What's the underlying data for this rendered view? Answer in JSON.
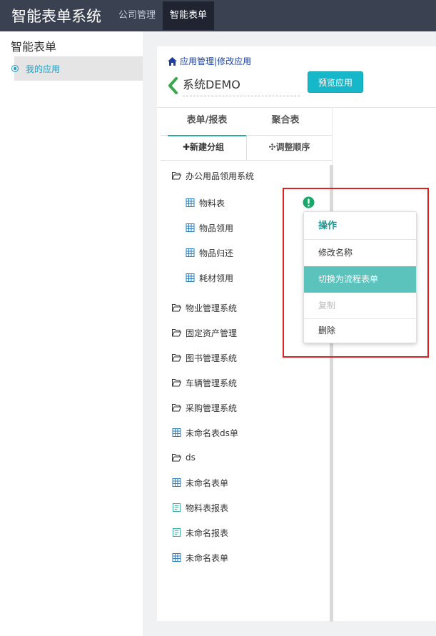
{
  "topbar": {
    "title": "智能表单系统",
    "nav": [
      {
        "label": "公司管理",
        "active": false
      },
      {
        "label": "智能表单",
        "active": true
      }
    ]
  },
  "sidebar": {
    "title": "智能表单",
    "items": [
      {
        "label": "我的应用",
        "icon": "radio-icon"
      }
    ]
  },
  "main": {
    "breadcrumb": {
      "app_manage": "应用管理",
      "separator": "|",
      "edit_app": "修改应用"
    },
    "app_name": "系统DEMO",
    "preview_label": "预览应用"
  },
  "panel": {
    "tabs": [
      {
        "label": "表单/报表",
        "active": true
      },
      {
        "label": "聚合表",
        "active": false
      }
    ],
    "toolbar": {
      "new_group": "✚新建分组",
      "reorder": "✣调整顺序"
    }
  },
  "tree": [
    {
      "label": "办公用品领用系统",
      "type": "folder",
      "level": 0
    },
    {
      "label": "物料表",
      "type": "form",
      "level": 1
    },
    {
      "label": "物品领用",
      "type": "form",
      "level": 1
    },
    {
      "label": "物品归还",
      "type": "form",
      "level": 1
    },
    {
      "label": "耗材领用",
      "type": "form",
      "level": 1
    },
    {
      "label": "物业管理系统",
      "type": "folder",
      "level": 0
    },
    {
      "label": "固定资产管理",
      "type": "folder",
      "level": 0
    },
    {
      "label": "图书管理系统",
      "type": "folder",
      "level": 0
    },
    {
      "label": "车辆管理系统",
      "type": "folder",
      "level": 0
    },
    {
      "label": "采购管理系统",
      "type": "folder",
      "level": 0
    },
    {
      "label": "未命名表ds单",
      "type": "form",
      "level": 0
    },
    {
      "label": "ds",
      "type": "folder",
      "level": 0
    },
    {
      "label": "未命名表单",
      "type": "form",
      "level": 0
    },
    {
      "label": "物料表报表",
      "type": "report",
      "level": 0
    },
    {
      "label": "未命名报表",
      "type": "report",
      "level": 0
    },
    {
      "label": "未命名表单",
      "type": "form",
      "level": 0
    }
  ],
  "context_menu": {
    "header": "操作",
    "items": [
      {
        "label": "修改名称",
        "state": "normal"
      },
      {
        "label": "切换为流程表单",
        "state": "selected"
      },
      {
        "label": "复制",
        "state": "disabled"
      },
      {
        "label": "删除",
        "state": "normal"
      }
    ]
  },
  "colors": {
    "topbar": "#3a4150",
    "accent": "#16b7c8",
    "tree_icon": "#2a7fc1",
    "report_icon": "#2aa89a",
    "menu_selected": "#5cc3bc",
    "highlight_box": "#e02020"
  },
  "icons": {
    "home": "home-icon",
    "back": "chevron-left-icon",
    "folder": "folder-open-icon",
    "form": "table-grid-icon",
    "report": "report-icon",
    "warning": "exclamation-circle-icon"
  }
}
